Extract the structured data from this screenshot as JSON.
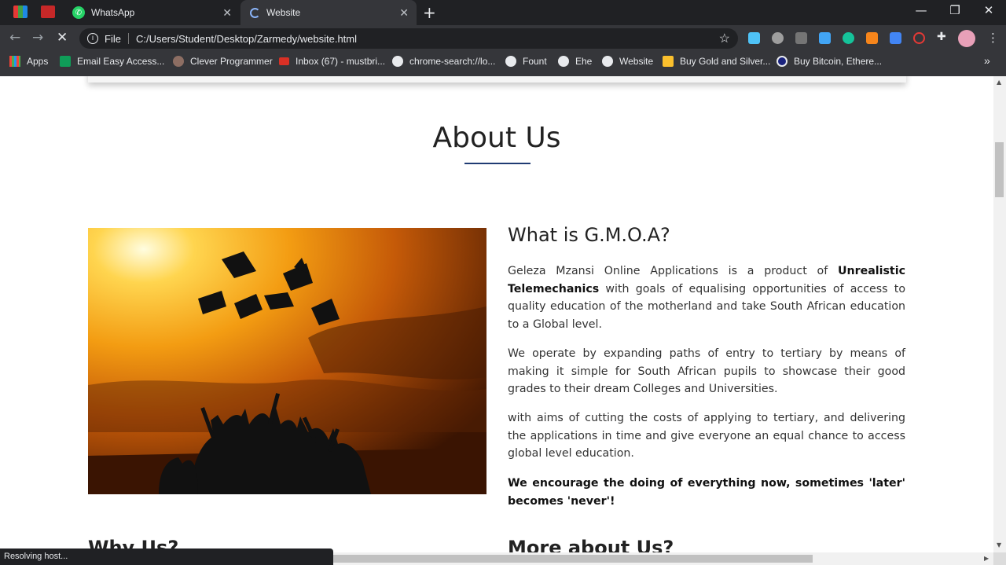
{
  "browser": {
    "tabs": [
      {
        "label": "WhatsApp",
        "icon": "whatsapp-icon",
        "active": false
      },
      {
        "label": "Website",
        "icon": "loading-icon",
        "active": true
      }
    ],
    "url_scheme": "File",
    "url": "C:/Users/Student/Desktop/Zarmedy/website.html",
    "bookmarks": [
      {
        "label": "Apps",
        "icon": "apps-grid-icon"
      },
      {
        "label": "Email Easy Access...",
        "icon": "sheets-icon"
      },
      {
        "label": "Clever Programmer",
        "icon": "avatar-icon"
      },
      {
        "label": "Inbox (67) - mustbri...",
        "icon": "gmail-icon"
      },
      {
        "label": "chrome-search://lo...",
        "icon": "globe-icon"
      },
      {
        "label": "Fount",
        "icon": "globe-icon"
      },
      {
        "label": "Ehe",
        "icon": "globe-icon"
      },
      {
        "label": "Website",
        "icon": "globe-icon"
      },
      {
        "label": "Buy Gold and Silver...",
        "icon": "folder-icon"
      },
      {
        "label": "Buy Bitcoin, Ethere...",
        "icon": "coin-icon"
      }
    ],
    "overflow_label": "»",
    "status": "Resolving host..."
  },
  "page": {
    "about_title": "About Us",
    "what_heading": "What is G.M.O.A?",
    "para1": {
      "lead": "Geleza Mzansi Online Applications is a product of ",
      "bold": "Unrealistic Telemechanics",
      "rest": " with goals of equalising opportunities of access to quality education of the motherland and take South African education to a Global level."
    },
    "para2": "We operate by expanding paths of entry to tertiary by means of making it simple for South African pupils to showcase their good grades to their dream Colleges and Universities.",
    "para3": "with aims of cutting the costs of applying to tertiary, and delivering the applications in time and give everyone an equal chance to access global level education.",
    "para4": "We encourage the doing of everything now, sometimes 'later' becomes 'never'!",
    "why_heading": "Why Us?",
    "more_heading": "More about Us?"
  },
  "colors": {
    "accent": "#1f3b73",
    "chrome_dark": "#202124",
    "chrome_toolbar": "#35363a"
  }
}
